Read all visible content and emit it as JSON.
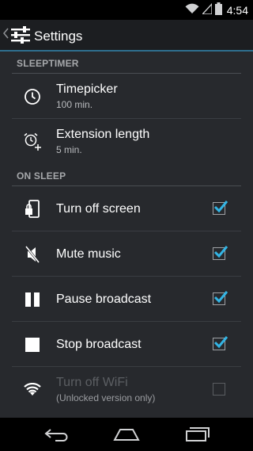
{
  "status_bar": {
    "time": "4:54",
    "icons": [
      "wifi-icon",
      "signal-icon",
      "battery-icon"
    ]
  },
  "action_bar": {
    "title": "Settings",
    "icons": [
      "up-caret-icon",
      "sliders-icon"
    ]
  },
  "sections": {
    "sleeptimer": {
      "header": "SLEEPTIMER",
      "items": [
        {
          "title": "Timepicker",
          "summary": "100 min.",
          "icon": "clock-icon"
        },
        {
          "title": "Extension length",
          "summary": "5 min.",
          "icon": "alarm-add-icon"
        }
      ]
    },
    "on_sleep": {
      "header": "ON SLEEP",
      "items": [
        {
          "title": "Turn off screen",
          "checked": true,
          "icon": "screen-lock-icon"
        },
        {
          "title": "Mute music",
          "checked": true,
          "icon": "mute-icon"
        },
        {
          "title": "Pause broadcast",
          "checked": true,
          "icon": "pause-icon"
        },
        {
          "title": "Stop broadcast",
          "checked": true,
          "icon": "stop-icon"
        },
        {
          "title": "Turn off WiFi",
          "summary": "(Unlocked version only)",
          "checked": false,
          "enabled": false,
          "icon": "wifi-icon"
        }
      ]
    }
  },
  "nav_bar": {
    "buttons": [
      "back-icon",
      "home-icon",
      "recents-icon"
    ]
  },
  "colors": {
    "accent": "#33b5e5",
    "divider_accent": "#2f6f8e",
    "background": "#27292d",
    "action_bar": "#1c1e21"
  }
}
